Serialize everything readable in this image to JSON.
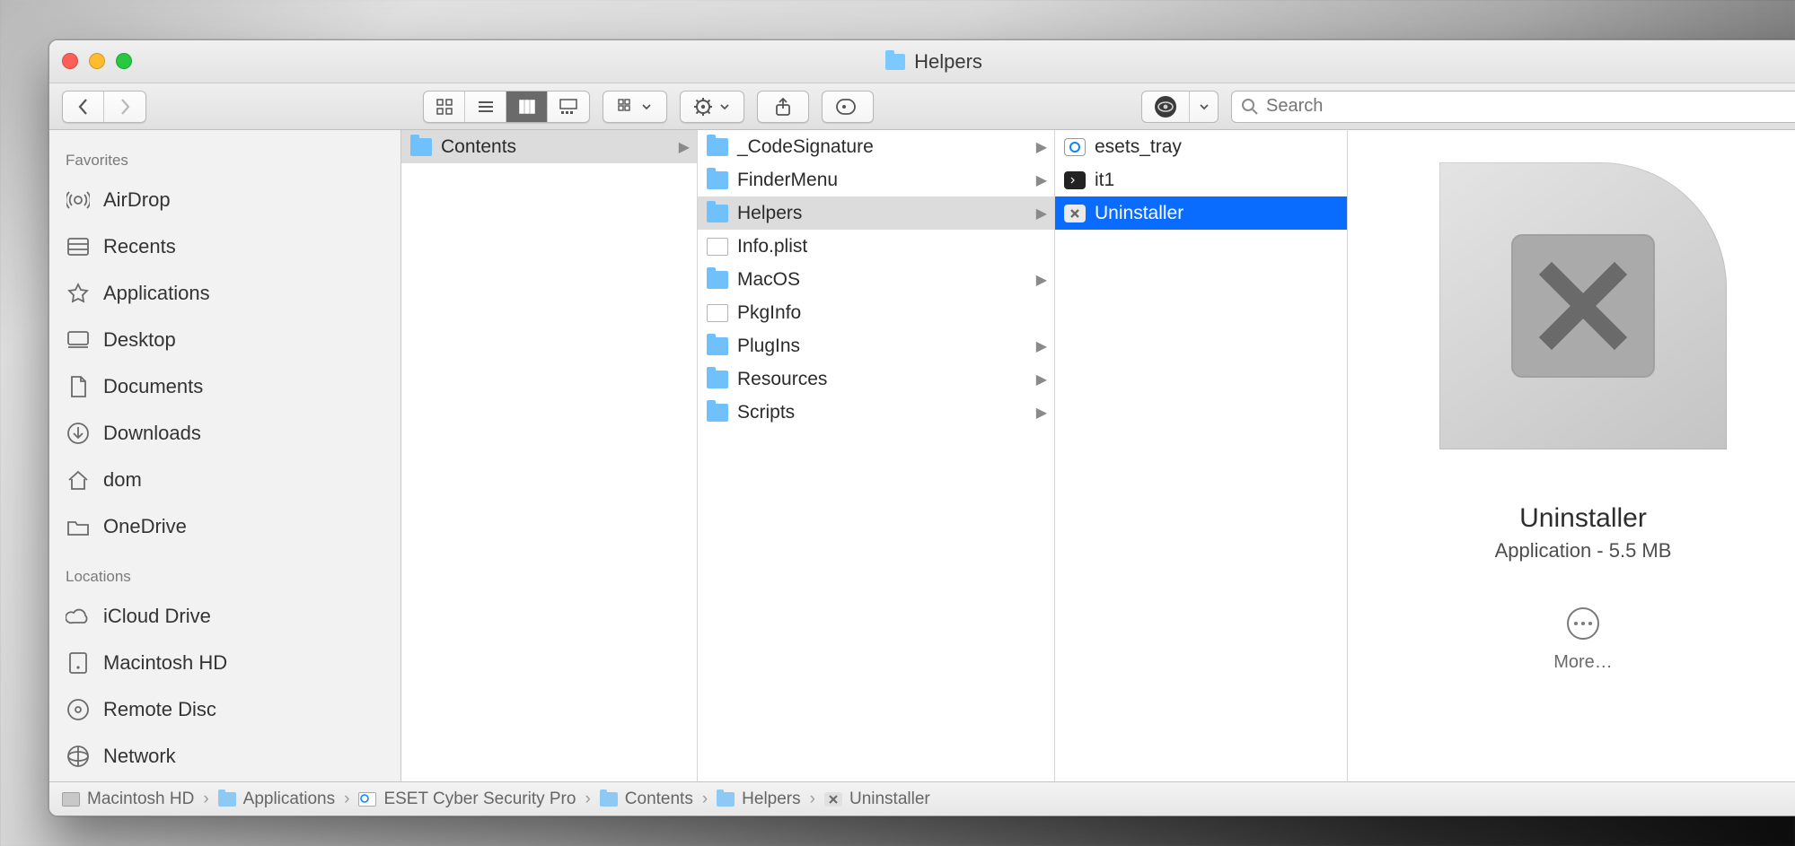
{
  "window": {
    "title": "Helpers"
  },
  "search": {
    "placeholder": "Search"
  },
  "sidebar": {
    "sections": [
      {
        "heading": "Favorites",
        "items": [
          {
            "label": "AirDrop",
            "icon": "airdrop"
          },
          {
            "label": "Recents",
            "icon": "recents"
          },
          {
            "label": "Applications",
            "icon": "applications"
          },
          {
            "label": "Desktop",
            "icon": "desktop"
          },
          {
            "label": "Documents",
            "icon": "documents"
          },
          {
            "label": "Downloads",
            "icon": "downloads"
          },
          {
            "label": "dom",
            "icon": "home"
          },
          {
            "label": "OneDrive",
            "icon": "folder"
          }
        ]
      },
      {
        "heading": "Locations",
        "items": [
          {
            "label": "iCloud Drive",
            "icon": "cloud"
          },
          {
            "label": "Macintosh HD",
            "icon": "hdd"
          },
          {
            "label": "Remote Disc",
            "icon": "disc"
          },
          {
            "label": "Network",
            "icon": "network"
          }
        ]
      }
    ]
  },
  "columns": {
    "col1": [
      {
        "label": "Contents",
        "type": "folder",
        "hasChildren": true,
        "selected": true
      }
    ],
    "col2": [
      {
        "label": "_CodeSignature",
        "type": "folder",
        "hasChildren": true
      },
      {
        "label": "FinderMenu",
        "type": "folder",
        "hasChildren": true
      },
      {
        "label": "Helpers",
        "type": "folder",
        "hasChildren": true,
        "selected": true
      },
      {
        "label": "Info.plist",
        "type": "file"
      },
      {
        "label": "MacOS",
        "type": "folder",
        "hasChildren": true
      },
      {
        "label": "PkgInfo",
        "type": "file"
      },
      {
        "label": "PlugIns",
        "type": "folder",
        "hasChildren": true
      },
      {
        "label": "Resources",
        "type": "folder",
        "hasChildren": true
      },
      {
        "label": "Scripts",
        "type": "folder",
        "hasChildren": true
      }
    ],
    "col3": [
      {
        "label": "esets_tray",
        "type": "app"
      },
      {
        "label": "it1",
        "type": "term"
      },
      {
        "label": "Uninstaller",
        "type": "xapp",
        "selected": true
      }
    ]
  },
  "preview": {
    "title": "Uninstaller",
    "subtitle": "Application - 5.5 MB",
    "more": "More…"
  },
  "pathbar": [
    {
      "label": "Macintosh HD",
      "icon": "hdd"
    },
    {
      "label": "Applications",
      "icon": "folder"
    },
    {
      "label": "ESET Cyber Security Pro",
      "icon": "app"
    },
    {
      "label": "Contents",
      "icon": "folder"
    },
    {
      "label": "Helpers",
      "icon": "folder"
    },
    {
      "label": "Uninstaller",
      "icon": "x"
    }
  ]
}
